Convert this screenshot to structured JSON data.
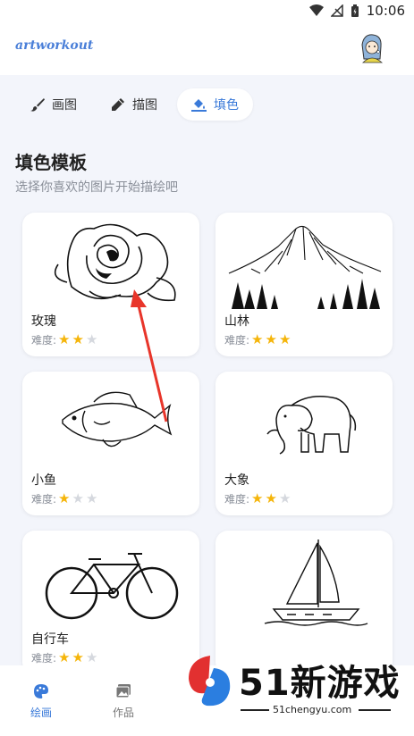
{
  "status": {
    "time": "10:06"
  },
  "app": {
    "logo_text": "artworkout"
  },
  "tabs": [
    {
      "label": "画图",
      "icon": "brush-icon",
      "active": false
    },
    {
      "label": "描图",
      "icon": "pen-icon",
      "active": false
    },
    {
      "label": "填色",
      "icon": "paint-bucket-icon",
      "active": true
    }
  ],
  "section": {
    "title": "填色模板",
    "subtitle": "选择你喜欢的图片开始描绘吧"
  },
  "cards": [
    {
      "name": "玫瑰",
      "difficulty_label": "难度:",
      "difficulty": 2,
      "icon": "rose-drawing"
    },
    {
      "name": "山林",
      "difficulty_label": "难度:",
      "difficulty": 3,
      "icon": "mountain-drawing"
    },
    {
      "name": "小鱼",
      "difficulty_label": "难度:",
      "difficulty": 1,
      "icon": "fish-drawing"
    },
    {
      "name": "大象",
      "difficulty_label": "难度:",
      "difficulty": 2,
      "icon": "elephant-drawing"
    },
    {
      "name": "自行车",
      "difficulty_label": "难度:",
      "difficulty": 2,
      "icon": "bicycle-drawing"
    },
    {
      "name": "",
      "difficulty_label": "",
      "difficulty": 0,
      "icon": "sailboat-drawing"
    }
  ],
  "bottom_nav": [
    {
      "label": "绘画",
      "icon": "palette-icon",
      "active": true
    },
    {
      "label": "作品",
      "icon": "gallery-icon",
      "active": false
    }
  ],
  "watermark": {
    "brand": "51新游戏",
    "url": "51chengyu.com"
  },
  "colors": {
    "accent": "#3a7ad9",
    "star": "#f5b50a",
    "arrow": "#e8352a"
  }
}
